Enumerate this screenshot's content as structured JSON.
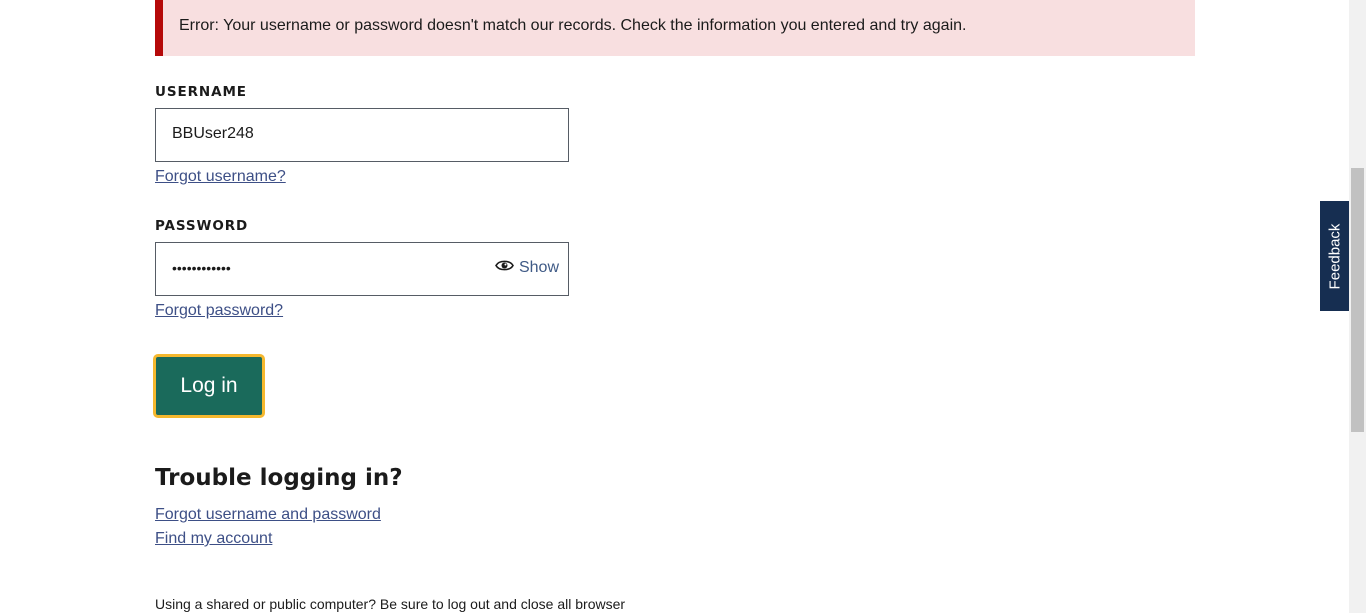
{
  "error": {
    "message": "Error: Your username or password doesn't match our records. Check the information you entered and try again."
  },
  "username": {
    "label": "USERNAME",
    "value": "BBUser248",
    "forgot_link": "Forgot username?"
  },
  "password": {
    "label": "PASSWORD",
    "masked_value": "••••••••••••",
    "show_label": "Show",
    "show_icon": "eye-icon",
    "forgot_link": "Forgot password?"
  },
  "login_button": {
    "label": "Log in"
  },
  "trouble": {
    "heading": "Trouble logging in?",
    "links": [
      "Forgot username and password",
      "Find my account"
    ]
  },
  "footnote": "Using a shared or public computer? Be sure to log out and close all browser",
  "feedback_tab": {
    "label": "Feedback"
  },
  "colors": {
    "error_bg": "#f8dfe0",
    "error_border": "#b50909",
    "button_bg": "#1a6a5b",
    "button_focus": "#f5b82e",
    "link": "#3d4f86",
    "feedback_bg": "#162e51"
  }
}
